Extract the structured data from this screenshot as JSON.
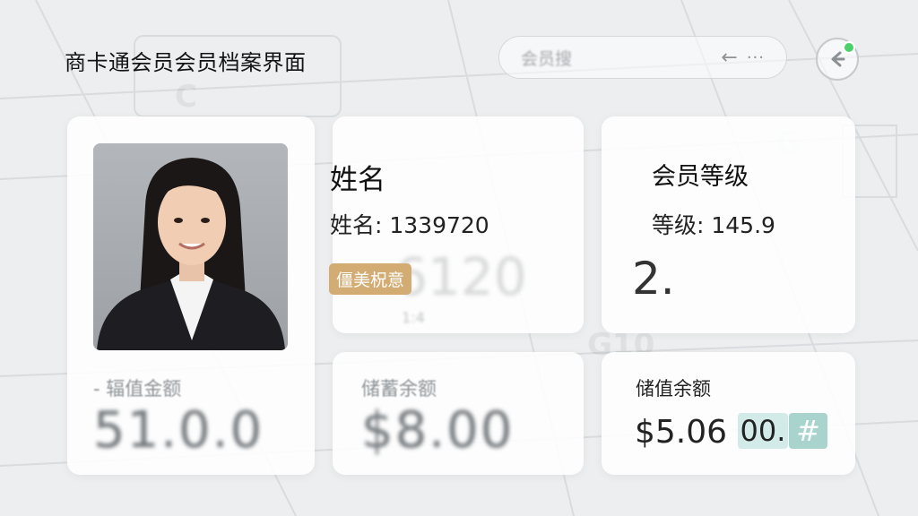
{
  "header": {
    "title": "商卡通会员会员档案界面",
    "search_placeholder": "会员搜",
    "search_arrow": "←",
    "search_more": "···",
    "back_icon": "back-arrow-icon",
    "status_dot_color": "#4cd16a"
  },
  "profile": {
    "photo_label": "member-photo",
    "balance_label": "- 辐值金额",
    "balance_amount": "51.0.0"
  },
  "name_card": {
    "heading": "姓名",
    "line": "姓名: 1339720",
    "badge": "僵美柷意",
    "ghost_number": "6120",
    "ghost_small": "1:4"
  },
  "level_card": {
    "heading": "会员等级",
    "line": "等级: 145.9",
    "level_value": "2."
  },
  "balance_card_2": {
    "label": "储蓄余额",
    "amount": "$8.00"
  },
  "balance_card_3": {
    "label": "储值余额",
    "amount_main": "$5.06",
    "chip_value": "00.",
    "chip_symbol": "#"
  },
  "background_marks": [
    "C",
    "G",
    "G10"
  ]
}
